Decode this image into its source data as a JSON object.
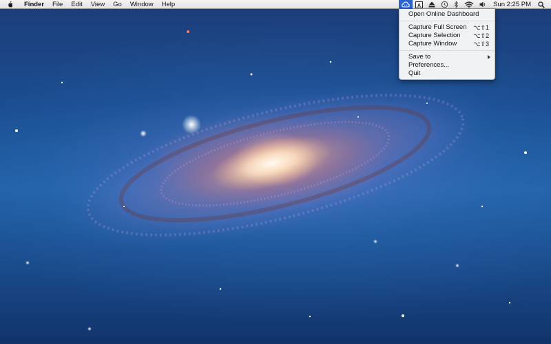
{
  "menubar": {
    "apple_icon": "apple-logo-icon",
    "app_name": "Finder",
    "items": [
      "File",
      "Edit",
      "View",
      "Go",
      "Window",
      "Help"
    ],
    "status_icons": [
      {
        "name": "cloud-capture-icon",
        "active": true
      },
      {
        "name": "text-input-icon",
        "active": false
      },
      {
        "name": "eject-icon",
        "active": false
      },
      {
        "name": "time-machine-icon",
        "active": false
      },
      {
        "name": "bluetooth-icon",
        "active": false
      },
      {
        "name": "wifi-icon",
        "active": false
      },
      {
        "name": "volume-icon",
        "active": false
      }
    ],
    "clock": "Sun 2:25 PM",
    "spotlight_icon": "spotlight-search-icon"
  },
  "status_menu": {
    "dashboard": "Open Online Dashboard",
    "capture_full": {
      "label": "Capture Full Screen",
      "shortcut": "⌥⇧1"
    },
    "capture_selection": {
      "label": "Capture Selection",
      "shortcut": "⌥⇧2"
    },
    "capture_window": {
      "label": "Capture Window",
      "shortcut": "⌥⇧3"
    },
    "save_to": "Save to",
    "preferences": "Preferences...",
    "quit": "Quit"
  },
  "colors": {
    "menu_highlight": "#2b62cc",
    "desktop_blue": "#1a4c8f"
  },
  "wallpaper": "andromeda-galaxy"
}
